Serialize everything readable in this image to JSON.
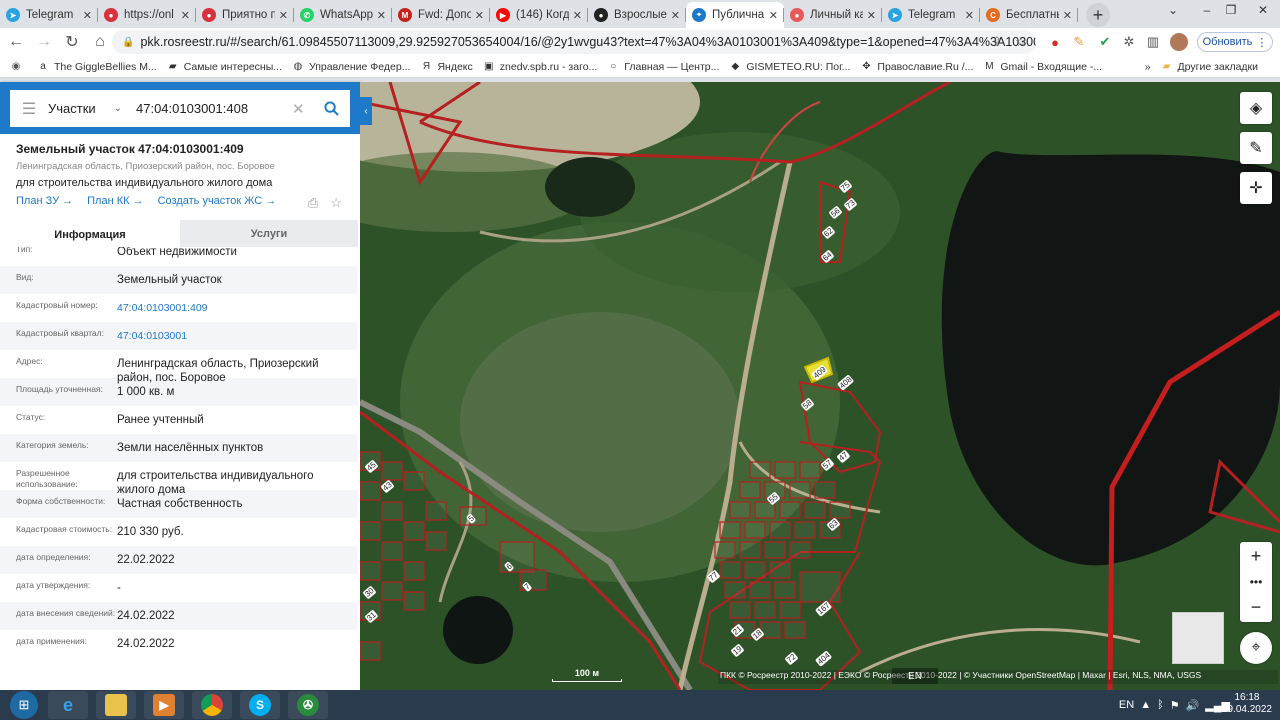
{
  "browser": {
    "tabs": [
      {
        "label": "Telegram",
        "color": "#2aa3e0",
        "icon": "telegram-icon",
        "glyph": "➤"
      },
      {
        "label": "https://onl",
        "color": "#d9323e",
        "icon": "site-icon",
        "glyph": "●"
      },
      {
        "label": "Приятно п",
        "color": "#d9323e",
        "icon": "site-icon",
        "glyph": "●"
      },
      {
        "label": "WhatsApp",
        "color": "#25d366",
        "icon": "whatsapp-icon",
        "glyph": "✆"
      },
      {
        "label": "Fwd: Допо",
        "color": "#c5221f",
        "icon": "gmail-icon",
        "glyph": "M"
      },
      {
        "label": "(146) Когда",
        "color": "#ff0000",
        "icon": "youtube-icon",
        "glyph": "▶"
      },
      {
        "label": "Взрослые",
        "color": "#222222",
        "icon": "site-icon",
        "glyph": "●"
      },
      {
        "label": "Публична",
        "color": "#1e79c8",
        "icon": "rosreestr-icon",
        "glyph": "⌖",
        "active": true
      },
      {
        "label": "Личный ка",
        "color": "#e85a5a",
        "icon": "site-icon",
        "glyph": "●"
      },
      {
        "label": "Telegram",
        "color": "#2aa3e0",
        "icon": "telegram-icon",
        "glyph": "➤"
      },
      {
        "label": "Бесплатны",
        "color": "#e56b1f",
        "icon": "site-icon",
        "glyph": "C"
      }
    ],
    "url": "pkk.rosreestr.ru/#/search/61.09845507113009,29.925927053654004/16/@2y1wvgu43?text=47%3A04%3A0103001%3A409&type=1&opened=47%3A4%3A103001%3A4...",
    "update_label": "Обновить",
    "bookmarks": [
      {
        "label": "The GiggleBellies M...",
        "icon": "amazon-icon",
        "glyph": "a"
      },
      {
        "label": "Самые интересны...",
        "icon": "folder-icon",
        "glyph": "▰"
      },
      {
        "label": "Управление Федер...",
        "icon": "globe-icon",
        "glyph": "◍"
      },
      {
        "label": "Яндекс",
        "icon": "yandex-icon",
        "glyph": "Я"
      },
      {
        "label": "znedv.spb.ru - заго...",
        "icon": "site-icon",
        "glyph": "▣"
      },
      {
        "label": "Главная — Центр...",
        "icon": "circle-icon",
        "glyph": "○"
      },
      {
        "label": "GISMETEO.RU: Пог...",
        "icon": "drop-icon",
        "glyph": "◆"
      },
      {
        "label": "Православие.Ru /...",
        "icon": "cross-icon",
        "glyph": "✥"
      },
      {
        "label": "Gmail - Входящие -...",
        "icon": "gmail-icon",
        "glyph": "M"
      }
    ],
    "other_bookmarks": "Другие закладки"
  },
  "search": {
    "type": "Участки",
    "query": "47:04:0103001:408"
  },
  "parcel": {
    "title": "Земельный участок 47:04:0103001:409",
    "address_small": "Ленинградская область, Приозерский район, пос. Боровое",
    "purpose": "для строительства индивидуального жилого дома",
    "links": [
      "План ЗУ →",
      "План КК →",
      "Создать участок ЖС →"
    ]
  },
  "tabs": {
    "info": "Информация",
    "services": "Услуги"
  },
  "details": [
    {
      "k": "Тип:",
      "v": "Объект недвижимости"
    },
    {
      "k": "Вид:",
      "v": "Земельный участок"
    },
    {
      "k": "Кадастровый номер:",
      "v": "47:04:0103001:409",
      "link": true
    },
    {
      "k": "Кадастровый квартал:",
      "v": "47:04:0103001",
      "link": true
    },
    {
      "k": "Адрес:",
      "v": "Ленинградская область, Приозерский район, пос. Боровое",
      "tall": true
    },
    {
      "k": "Площадь уточненная:",
      "v": "1 000 кв. м"
    },
    {
      "k": "Статус:",
      "v": "Ранее учтенный"
    },
    {
      "k": "Категория земель:",
      "v": "Земли населённых пунктов"
    },
    {
      "k": "Разрешенное использование:",
      "v": "для строительства индивидуального жилого дома",
      "tall": true
    },
    {
      "k": "Форма собственности:",
      "v": "Частная собственность"
    },
    {
      "k": "Кадастровая стоимость:",
      "v": "210 330 руб."
    },
    {
      "k": "дата определения:",
      "v": "22.02.2022"
    },
    {
      "k": "дата утверждения:",
      "v": "-"
    },
    {
      "k": "дата внесения сведений:",
      "v": "24.02.2022"
    },
    {
      "k": "дата применения:",
      "v": "24.02.2022"
    }
  ],
  "map": {
    "scale": "100 м",
    "attribution": "ПКК © Росреестр 2010-2022 | ЕЭКО © Росреестр 2010-2022 | © Участники OpenStreetMap | Maxar | Esri, NLS, NMA, USGS",
    "lang": "EN",
    "labels": [
      "75",
      "73",
      "56",
      "62",
      "64",
      "409",
      "408",
      "58",
      "57",
      "47",
      "55",
      "63",
      "45",
      "43",
      "5",
      "6",
      "7",
      "30",
      "31",
      "167",
      "72",
      "404",
      "77",
      "19",
      "21",
      "18"
    ]
  },
  "taskbar": {
    "time": "16:18",
    "date": "29.04.2022",
    "lang": "EN"
  }
}
